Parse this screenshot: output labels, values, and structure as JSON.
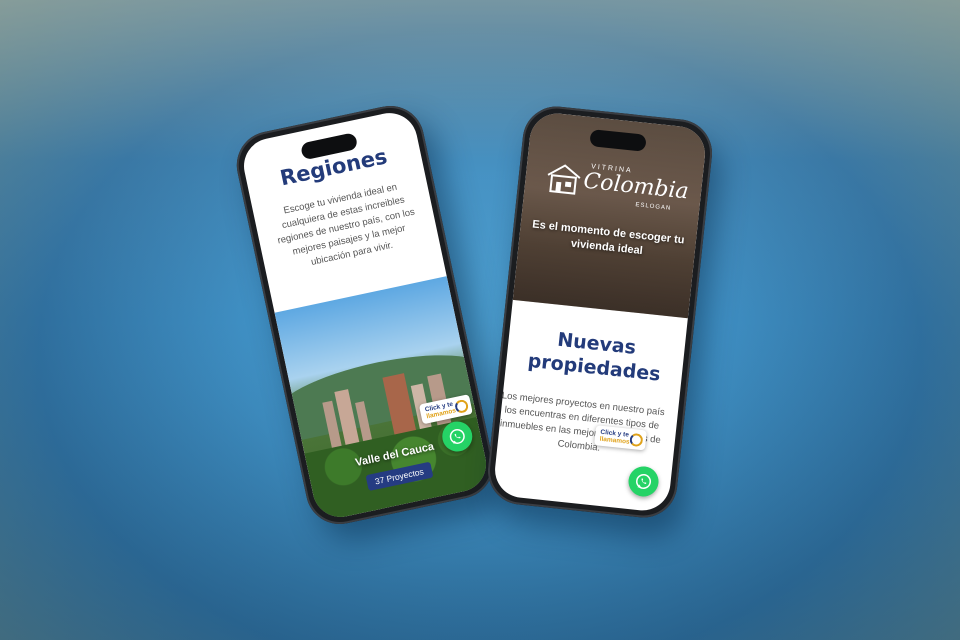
{
  "left_phone": {
    "title": "Regiones",
    "description": "Escoge tu vivienda ideal en cualquiera de estas increibles regiones de nuestro país, con los mejores paisajes y la mejor ubicación para vivir.",
    "region_card": {
      "name": "Valle del Cauca",
      "projects_badge": "37 Proyectos"
    },
    "click_widget": {
      "line1": "Click y te",
      "line2": "llamamos"
    }
  },
  "right_phone": {
    "logo": {
      "vitrina": "VITRINA",
      "name": "Colombia",
      "eslogan": "ESLOGAN"
    },
    "hero_tagline": "Es el momento de escoger tu vivienda ideal",
    "section_title": "Nuevas propiedades",
    "section_description": "Los mejores proyectos en nuestro país los encuentras en diferentes tipos de inmuebles en las mejores ciudades de Colombia.",
    "click_widget": {
      "line1": "Click y te",
      "line2": "llamamos"
    }
  },
  "icons": [
    "whatsapp-icon",
    "callback-icon",
    "house-logo-icon"
  ],
  "colors": {
    "brand_blue": "#233b7a",
    "whatsapp_green": "#25d366",
    "accent_gold": "#e0a21a"
  }
}
